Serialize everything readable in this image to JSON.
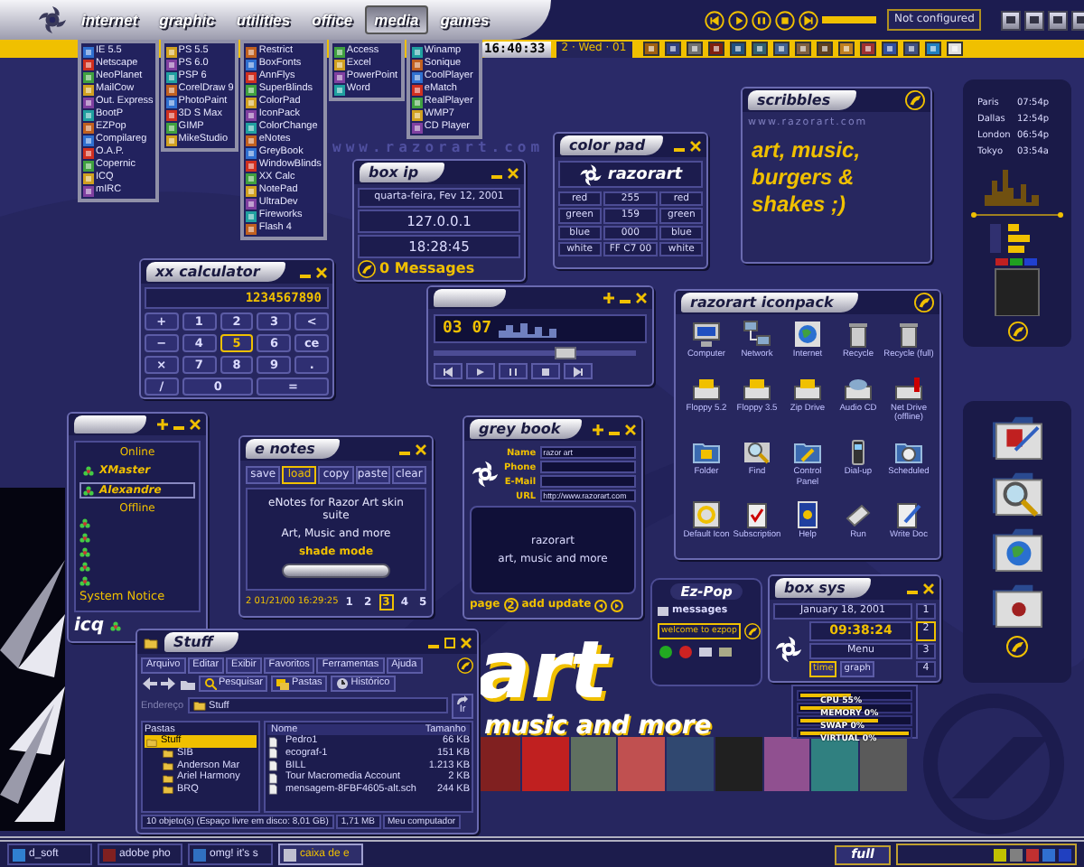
{
  "menubar": {
    "items": [
      {
        "label": "internet",
        "selected": false
      },
      {
        "label": "graphic",
        "selected": false
      },
      {
        "label": "utilities",
        "selected": false
      },
      {
        "label": "office",
        "selected": false
      },
      {
        "label": "media",
        "selected": true
      },
      {
        "label": "games",
        "selected": false
      }
    ],
    "player_status": "Not configured"
  },
  "clock": {
    "time": "16:40:33",
    "date": "2 · Wed · 01"
  },
  "launch_menu": {
    "columns": [
      [
        "IE 5.5",
        "Netscape",
        "NeoPlanet",
        "MailCow",
        "Out. Express",
        "BootP",
        "EZPop",
        "Compilareg",
        "O.A.P.",
        "Copernic",
        "ICQ",
        "mIRC"
      ],
      [
        "PS 5.5",
        "PS 6.0",
        "PSP 6",
        "CorelDraw 9",
        "PhotoPaint",
        "3D S Max",
        "GIMP",
        "MikeStudio"
      ],
      [
        "Restrict",
        "BoxFonts",
        "AnnFlys",
        "SuperBlinds",
        "ColorPad",
        "IconPack",
        "ColorChange",
        "eNotes",
        "GreyBook",
        "WindowBlinds",
        "XX Calc",
        "NotePad",
        "UltraDev",
        "Fireworks",
        "Flash 4"
      ],
      [
        "Access",
        "Excel",
        "PowerPoint",
        "Word"
      ],
      [
        "Winamp",
        "Sonique",
        "CoolPlayer",
        "eMatch",
        "RealPlayer",
        "WMP7",
        "CD Player"
      ]
    ]
  },
  "wallpaper": {
    "url": "www.razorart.com",
    "logo": "art",
    "tagline": "music and more"
  },
  "box_ip": {
    "title": "box ip",
    "date": "quarta-feira, Fev 12, 2001",
    "ip": "127.0.0.1",
    "time": "18:28:45",
    "messages": "0 Messages"
  },
  "color_pad": {
    "title": "color pad",
    "logo": "razorart",
    "rows": [
      {
        "left": "red",
        "value": "255",
        "right": "red"
      },
      {
        "left": "green",
        "value": "159",
        "right": "green"
      },
      {
        "left": "blue",
        "value": "000",
        "right": "blue"
      },
      {
        "left": "white",
        "value": "FF C7 00",
        "right": "white"
      }
    ]
  },
  "scribbles": {
    "title": "scribbles",
    "url": "www.razorart.com",
    "text": "art, music, burgers & shakes ;)"
  },
  "world_clock": [
    {
      "city": "Paris",
      "time": "07:54p"
    },
    {
      "city": "Dallas",
      "time": "12:54p"
    },
    {
      "city": "London",
      "time": "06:54p"
    },
    {
      "city": "Tokyo",
      "time": "03:54a"
    }
  ],
  "calculator": {
    "title": "xx calculator",
    "display": "1234567890",
    "keys": [
      {
        "label": "+",
        "kind": "key",
        "selected": false
      },
      {
        "label": "1",
        "kind": "key",
        "selected": false
      },
      {
        "label": "2",
        "kind": "key",
        "selected": false
      },
      {
        "label": "3",
        "kind": "key",
        "selected": false
      },
      {
        "label": "<",
        "kind": "key",
        "selected": false
      },
      {
        "label": "−",
        "kind": "key",
        "selected": false
      },
      {
        "label": "4",
        "kind": "key",
        "selected": false
      },
      {
        "label": "5",
        "kind": "key",
        "selected": true
      },
      {
        "label": "6",
        "kind": "key",
        "selected": false
      },
      {
        "label": "ce",
        "kind": "key",
        "selected": false
      },
      {
        "label": "×",
        "kind": "key",
        "selected": false
      },
      {
        "label": "7",
        "kind": "key",
        "selected": false
      },
      {
        "label": "8",
        "kind": "key",
        "selected": false
      },
      {
        "label": "9",
        "kind": "key",
        "selected": false
      },
      {
        "label": ".",
        "kind": "key",
        "selected": false
      },
      {
        "label": "/",
        "kind": "key",
        "selected": false
      },
      {
        "label": "0",
        "kind": "wide",
        "selected": false
      },
      {
        "label": "=",
        "kind": "wide",
        "selected": false
      }
    ]
  },
  "player": {
    "time": "03 07",
    "level": 0.65
  },
  "icon_pack": {
    "title": "razorart iconpack",
    "icons": [
      {
        "label": "Computer",
        "kind": "computer"
      },
      {
        "label": "Network",
        "kind": "network"
      },
      {
        "label": "Internet",
        "kind": "internet"
      },
      {
        "label": "Recycle",
        "kind": "recycle"
      },
      {
        "label": "Recycle (full)",
        "kind": "recycle"
      },
      {
        "label": "Floppy 5.2",
        "kind": "floppy"
      },
      {
        "label": "Floppy 3.5",
        "kind": "floppy"
      },
      {
        "label": "Zip Drive",
        "kind": "floppy"
      },
      {
        "label": "Audio CD",
        "kind": "cd"
      },
      {
        "label": "Net Drive (offline)",
        "kind": "netdrive"
      },
      {
        "label": "Folder",
        "kind": "folder"
      },
      {
        "label": "Find",
        "kind": "find"
      },
      {
        "label": "Control Panel",
        "kind": "control"
      },
      {
        "label": "Dial-up",
        "kind": "dialup"
      },
      {
        "label": "Scheduled",
        "kind": "scheduled"
      },
      {
        "label": "Default Icon",
        "kind": "default"
      },
      {
        "label": "Subscription",
        "kind": "subscription"
      },
      {
        "label": "Help",
        "kind": "help"
      },
      {
        "label": "Run",
        "kind": "run"
      },
      {
        "label": "Write Doc",
        "kind": "write"
      }
    ]
  },
  "icq": {
    "items": [
      {
        "kind": "header",
        "label": "Online"
      },
      {
        "kind": "contact",
        "label": "XMaster",
        "selected": false
      },
      {
        "kind": "contact",
        "label": "Alexandre",
        "selected": true
      },
      {
        "kind": "header",
        "label": "Offline"
      },
      {
        "kind": "notice",
        "label": "System Notice"
      }
    ],
    "brand": "icq"
  },
  "enotes": {
    "title": "e notes",
    "buttons": [
      {
        "label": "save",
        "selected": false
      },
      {
        "label": "load",
        "selected": true
      },
      {
        "label": "copy",
        "selected": false
      },
      {
        "label": "paste",
        "selected": false
      },
      {
        "label": "clear",
        "selected": false
      }
    ],
    "note": [
      "eNotes for Razor Art skin suite",
      "Art, Music and more"
    ],
    "shade_label": "shade mode",
    "stamp": "2 01/21/00 16:29:25",
    "pages": [
      {
        "label": "1",
        "selected": false
      },
      {
        "label": "2",
        "selected": false
      },
      {
        "label": "3",
        "selected": true
      },
      {
        "label": "4",
        "selected": false
      },
      {
        "label": "5",
        "selected": false
      }
    ]
  },
  "grey_book": {
    "title": "grey book",
    "fields": [
      {
        "label": "Name",
        "value": "razor art"
      },
      {
        "label": "Phone"
      },
      {
        "label": "E-Mail"
      },
      {
        "label": "URL",
        "value": "http://www.razorart.com"
      }
    ],
    "notes": [
      "razorart",
      "art, music and more"
    ],
    "page_label": "page",
    "page": "2",
    "actions": [
      "add",
      "update"
    ]
  },
  "ez_pop": {
    "title": "Ez-Pop",
    "messages": "messages",
    "status": "welcome to ezpop"
  },
  "box_sys": {
    "title": "box sys",
    "date": "January 18, 2001",
    "time": "09:38:24",
    "menu": "Menu",
    "tabs": [
      {
        "label": "time",
        "selected": true
      },
      {
        "label": "graph",
        "selected": false
      }
    ],
    "numbers": [
      {
        "label": "1",
        "selected": false
      },
      {
        "label": "2",
        "selected": true
      },
      {
        "label": "3",
        "selected": false
      },
      {
        "label": "4",
        "selected": false
      }
    ]
  },
  "system_meters": [
    {
      "label": "CPU 55%",
      "level": 0.45
    },
    {
      "label": "MEMORY 0%",
      "level": 0.55
    },
    {
      "label": "SWAP 0%",
      "level": 0.7
    },
    {
      "label": "VIRTUAL 0%",
      "level": 1
    }
  ],
  "explorer": {
    "title": "Stuff",
    "menu": [
      "Arquivo",
      "Editar",
      "Exibir",
      "Favoritos",
      "Ferramentas",
      "Ajuda"
    ],
    "toolbar": [
      "Pesquisar",
      "Pastas",
      "Histórico"
    ],
    "address_label": "Endereço",
    "address": "Stuff",
    "go": "Ir",
    "tree_label": "Pastas",
    "tree": [
      {
        "label": "Stuff",
        "selected": true,
        "children": [
          {
            "label": "SIB",
            "selected": false
          },
          {
            "label": "Anderson Mar",
            "selected": false
          },
          {
            "label": "Ariel Harmony",
            "selected": false
          },
          {
            "label": "BRQ",
            "selected": false
          }
        ]
      }
    ],
    "columns": [
      "Nome",
      "Tamanho"
    ],
    "files": [
      {
        "name": "Pedro1",
        "size": "66 KB"
      },
      {
        "name": "ecograf-1",
        "size": "151 KB"
      },
      {
        "name": "BILL",
        "size": "1.213 KB"
      },
      {
        "name": "Tour Macromedia Account",
        "size": "2 KB"
      },
      {
        "name": "mensagem-8FBF4605-alt.sch",
        "size": "244 KB"
      }
    ],
    "status": [
      "10 objeto(s) (Espaço livre em disco: 8,01 GB)",
      "1,71 MB",
      "Meu computador"
    ]
  },
  "taskbar": {
    "tasks": [
      {
        "label": "d_soft",
        "selected": false
      },
      {
        "label": "adobe pho",
        "selected": false
      },
      {
        "label": "omg! it's s",
        "selected": false
      },
      {
        "label": "caixa de e",
        "selected": true
      }
    ],
    "button": "full"
  }
}
